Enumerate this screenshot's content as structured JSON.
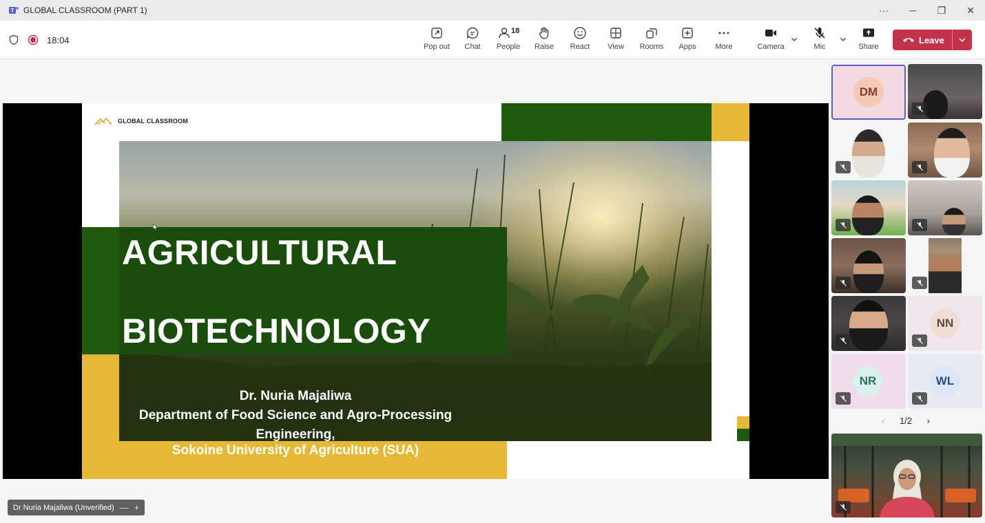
{
  "window": {
    "title": "GLOBAL CLASSROOM (PART 1)",
    "controls": [
      "···",
      "─",
      "❐",
      "✕"
    ]
  },
  "toolbar": {
    "timer": "18:04",
    "buttons": [
      {
        "id": "pop-out",
        "label": "Pop out",
        "icon": "pop-out-icon"
      },
      {
        "id": "chat",
        "label": "Chat",
        "icon": "chat-icon"
      },
      {
        "id": "people",
        "label": "People",
        "icon": "people-icon",
        "badge": "18"
      },
      {
        "id": "raise",
        "label": "Raise",
        "icon": "hand-icon"
      },
      {
        "id": "react",
        "label": "React",
        "icon": "smile-icon"
      },
      {
        "id": "view",
        "label": "View",
        "icon": "grid-icon"
      },
      {
        "id": "rooms",
        "label": "Rooms",
        "icon": "rooms-icon"
      },
      {
        "id": "apps",
        "label": "Apps",
        "icon": "plus-icon"
      },
      {
        "id": "more",
        "label": "More",
        "icon": "ellipsis-icon"
      },
      {
        "id": "camera",
        "label": "Camera",
        "icon": "camera-icon"
      },
      {
        "id": "mic",
        "label": "Mic",
        "icon": "mic-off-icon"
      },
      {
        "id": "share",
        "label": "Share",
        "icon": "share-icon"
      }
    ],
    "leave_label": "Leave",
    "leave_color": "#c4314b"
  },
  "slide": {
    "brand": "GLOBAL CLASSROOM",
    "title_line1": "AGRICULTURAL",
    "title_line2": "BIOTECHNOLOGY",
    "author_lines": [
      "Dr. Nuria Majaliwa",
      "Department of Food Science and Agro-Processing",
      "Engineering,"
    ],
    "university": "Sokoine University of Agriculture (SUA)",
    "colors": {
      "green": "#1f5a10",
      "yellow": "#e5b935"
    }
  },
  "presenter_tag": {
    "name": "Dr Nuria Majaliwa (Unverified)",
    "minus": "—",
    "plus": "+"
  },
  "gallery": {
    "pager": {
      "text": "1/2",
      "prev": "‹",
      "next": "›"
    },
    "avatar_tiles": [
      {
        "initials": "DM",
        "bg": "#f3d9e0",
        "avatar_bg": "#f5c9b8",
        "color": "#8a3b2c"
      },
      {
        "initials": "NN",
        "bg": "#efe6ef",
        "avatar_bg": "#f0ded5",
        "color": "#5e4a3f"
      },
      {
        "initials": "NR",
        "bg": "#f0dcec",
        "avatar_bg": "#d9f0ee",
        "color": "#2e6f69"
      },
      {
        "initials": "WL",
        "bg": "#e7eaf2",
        "avatar_bg": "#dce6f7",
        "color": "#2d4f86"
      }
    ]
  }
}
